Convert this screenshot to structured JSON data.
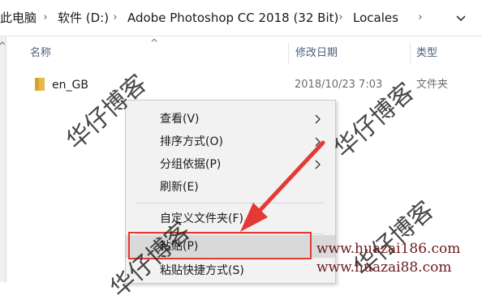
{
  "address_bar": {
    "breadcrumbs": [
      {
        "label": "此电脑"
      },
      {
        "label": "软件 (D:)"
      },
      {
        "label": "Adobe Photoshop CC 2018 (32 Bit)"
      },
      {
        "label": "Locales"
      }
    ],
    "chevron": "›"
  },
  "columns": {
    "name": "名称",
    "date_modified": "修改日期",
    "type": "类型",
    "sort_arrow": "^"
  },
  "files": [
    {
      "name": "en_GB",
      "date_modified": "2018/10/23 7:03",
      "type": "文件夹",
      "icon": "folder-icon"
    }
  ],
  "context_menu": {
    "items": [
      {
        "label": "查看(V)",
        "has_submenu": true
      },
      {
        "label": "排序方式(O)",
        "has_submenu": true
      },
      {
        "label": "分组依据(P)",
        "has_submenu": true
      },
      {
        "label": "刷新(E)",
        "has_submenu": false
      },
      {
        "label": "自定义文件夹(F)...",
        "has_submenu": false
      },
      {
        "label": "粘贴(P)",
        "has_submenu": false,
        "highlighted": true
      },
      {
        "label": "粘贴快捷方式(S)",
        "has_submenu": false
      }
    ]
  },
  "annotations": {
    "highlight_color": "#e53935",
    "arrow_color": "#e53935"
  },
  "watermarks": {
    "text": "华仔博客",
    "urls": [
      "www.huazai186.com",
      "www.huazai88.com"
    ]
  }
}
